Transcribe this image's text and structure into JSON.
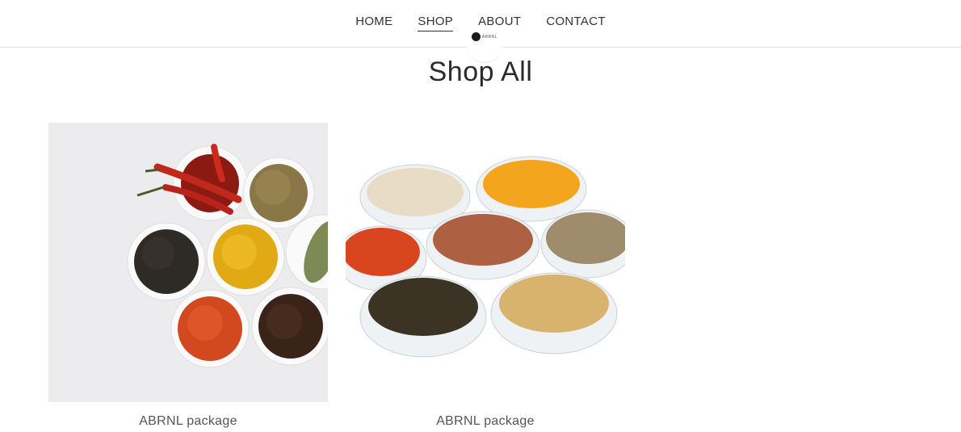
{
  "nav": {
    "items": [
      {
        "label": "HOME"
      },
      {
        "label": "SHOP",
        "active": true
      },
      {
        "label": "ABOUT"
      },
      {
        "label": "CONTACT"
      }
    ]
  },
  "logo": {
    "text": "ABRNL"
  },
  "page": {
    "title": "Shop All"
  },
  "products": [
    {
      "name": "ABRNL package",
      "image": "spice-bowls-top-view"
    },
    {
      "name": "ABRNL package",
      "image": "spice-powders-glass-bowls"
    }
  ]
}
